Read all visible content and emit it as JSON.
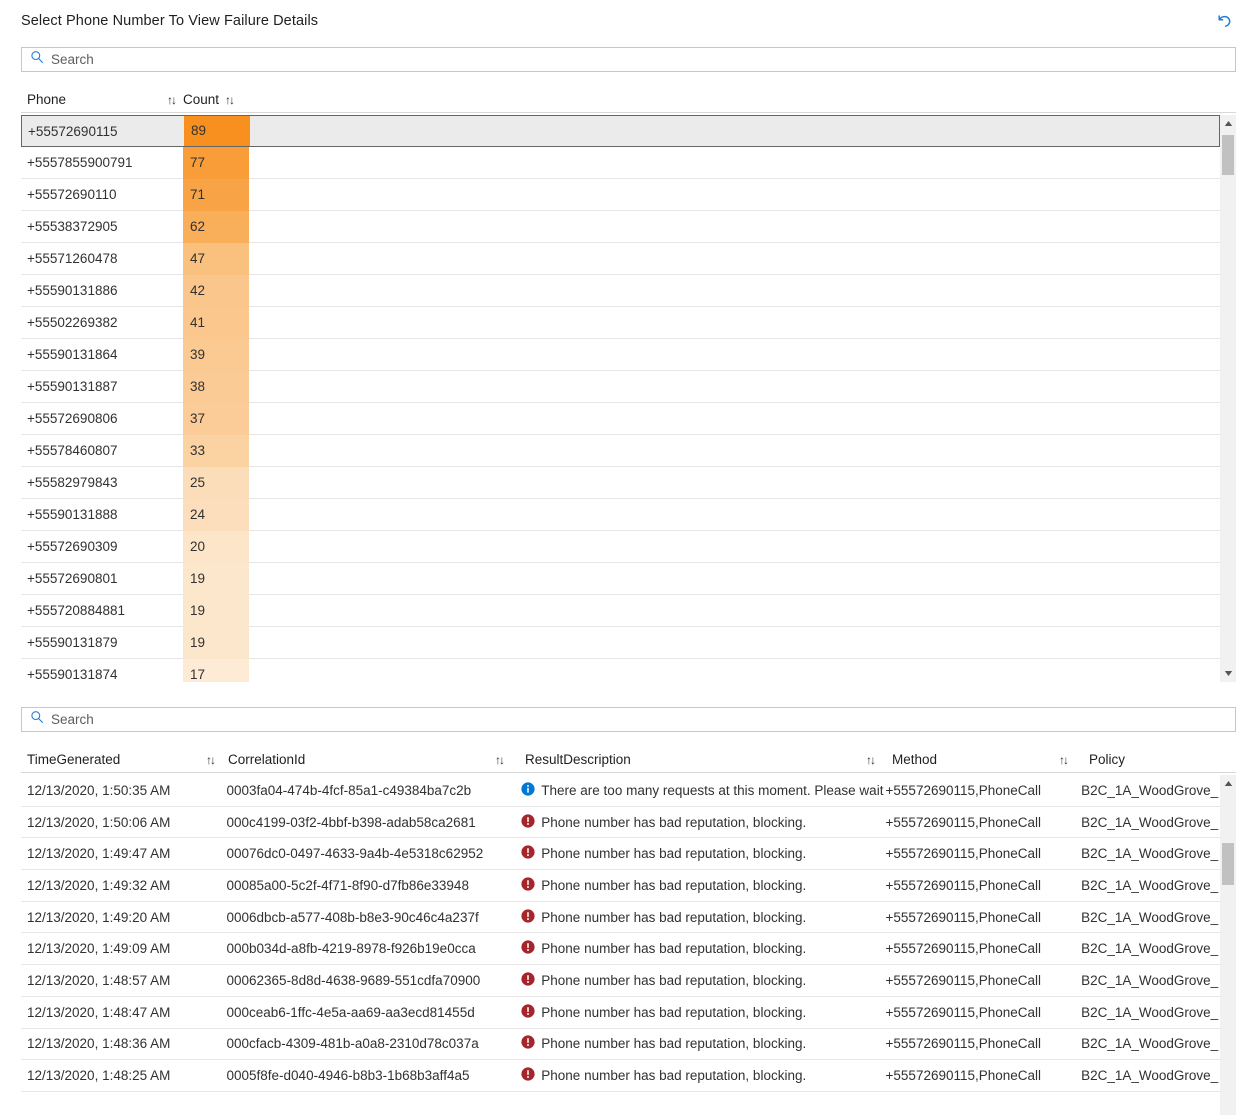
{
  "header": {
    "title": "Select Phone Number To View Failure Details",
    "reset_icon": "undo-arrow-icon"
  },
  "search_top": {
    "placeholder": "Search",
    "value": "",
    "icon": "search-icon"
  },
  "search_bottom": {
    "placeholder": "Search",
    "value": "",
    "icon": "search-icon"
  },
  "colors": {
    "accent_blue": "#0078d4",
    "heat_max": "#f7901e",
    "heat_min": "#fdebd5",
    "error_red": "#a4262c",
    "info_blue": "#0078d4",
    "selected_row_bg": "#ebebeb",
    "grid_line": "#e6e6e6"
  },
  "phones_grid": {
    "columns": [
      {
        "label": "Phone",
        "sort_icon": "sort-arrows-icon"
      },
      {
        "label": "Count",
        "sort_icon": "sort-arrows-icon"
      }
    ],
    "selected_index": 0,
    "rows": [
      {
        "phone": "+55572690115",
        "count": "89"
      },
      {
        "phone": "+5557855900791",
        "count": "77"
      },
      {
        "phone": "+55572690110",
        "count": "71"
      },
      {
        "phone": "+55538372905",
        "count": "62"
      },
      {
        "phone": "+55571260478",
        "count": "47"
      },
      {
        "phone": "+55590131886",
        "count": "42"
      },
      {
        "phone": "+55502269382",
        "count": "41"
      },
      {
        "phone": "+55590131864",
        "count": "39"
      },
      {
        "phone": "+55590131887",
        "count": "38"
      },
      {
        "phone": "+55572690806",
        "count": "37"
      },
      {
        "phone": "+55578460807",
        "count": "33"
      },
      {
        "phone": "+55582979843",
        "count": "25"
      },
      {
        "phone": "+55590131888",
        "count": "24"
      },
      {
        "phone": "+55572690309",
        "count": "20"
      },
      {
        "phone": "+55572690801",
        "count": "19"
      },
      {
        "phone": "+555720884881",
        "count": "19"
      },
      {
        "phone": "+55590131879",
        "count": "19"
      },
      {
        "phone": "+55590131874",
        "count": "17"
      }
    ]
  },
  "logs_grid": {
    "columns": [
      {
        "label": "TimeGenerated",
        "sort_icon": "sort-arrows-icon"
      },
      {
        "label": "CorrelationId",
        "sort_icon": "sort-arrows-icon"
      },
      {
        "label": "ResultDescription",
        "sort_icon": "sort-arrows-icon"
      },
      {
        "label": "Method",
        "sort_icon": "sort-arrows-icon"
      },
      {
        "label": "Policy",
        "sort_icon": null
      }
    ],
    "rows": [
      {
        "time": "12/13/2020, 1:50:35 AM",
        "correlation_id": "0003fa04-474b-4fcf-85a1-c49384ba7c2b",
        "severity": "info",
        "severity_icon": "info-circle-icon",
        "result_description": "There are too many requests at this moment. Please wait fo",
        "method": "+55572690115,PhoneCall",
        "policy": "B2C_1A_WoodGrove_"
      },
      {
        "time": "12/13/2020, 1:50:06 AM",
        "correlation_id": "000c4199-03f2-4bbf-b398-adab58ca2681",
        "severity": "error",
        "severity_icon": "error-circle-icon",
        "result_description": "Phone number has bad reputation, blocking.",
        "method": "+55572690115,PhoneCall",
        "policy": "B2C_1A_WoodGrove_"
      },
      {
        "time": "12/13/2020, 1:49:47 AM",
        "correlation_id": "00076dc0-0497-4633-9a4b-4e5318c62952",
        "severity": "error",
        "severity_icon": "error-circle-icon",
        "result_description": "Phone number has bad reputation, blocking.",
        "method": "+55572690115,PhoneCall",
        "policy": "B2C_1A_WoodGrove_"
      },
      {
        "time": "12/13/2020, 1:49:32 AM",
        "correlation_id": "00085a00-5c2f-4f71-8f90-d7fb86e33948",
        "severity": "error",
        "severity_icon": "error-circle-icon",
        "result_description": "Phone number has bad reputation, blocking.",
        "method": "+55572690115,PhoneCall",
        "policy": "B2C_1A_WoodGrove_"
      },
      {
        "time": "12/13/2020, 1:49:20 AM",
        "correlation_id": "0006dbcb-a577-408b-b8e3-90c46c4a237f",
        "severity": "error",
        "severity_icon": "error-circle-icon",
        "result_description": "Phone number has bad reputation, blocking.",
        "method": "+55572690115,PhoneCall",
        "policy": "B2C_1A_WoodGrove_"
      },
      {
        "time": "12/13/2020, 1:49:09 AM",
        "correlation_id": "000b034d-a8fb-4219-8978-f926b19e0cca",
        "severity": "error",
        "severity_icon": "error-circle-icon",
        "result_description": "Phone number has bad reputation, blocking.",
        "method": "+55572690115,PhoneCall",
        "policy": "B2C_1A_WoodGrove_"
      },
      {
        "time": "12/13/2020, 1:48:57 AM",
        "correlation_id": "00062365-8d8d-4638-9689-551cdfa70900",
        "severity": "error",
        "severity_icon": "error-circle-icon",
        "result_description": "Phone number has bad reputation, blocking.",
        "method": "+55572690115,PhoneCall",
        "policy": "B2C_1A_WoodGrove_"
      },
      {
        "time": "12/13/2020, 1:48:47 AM",
        "correlation_id": "000ceab6-1ffc-4e5a-aa69-aa3ecd81455d",
        "severity": "error",
        "severity_icon": "error-circle-icon",
        "result_description": "Phone number has bad reputation, blocking.",
        "method": "+55572690115,PhoneCall",
        "policy": "B2C_1A_WoodGrove_"
      },
      {
        "time": "12/13/2020, 1:48:36 AM",
        "correlation_id": "000cfacb-4309-481b-a0a8-2310d78c037a",
        "severity": "error",
        "severity_icon": "error-circle-icon",
        "result_description": "Phone number has bad reputation, blocking.",
        "method": "+55572690115,PhoneCall",
        "policy": "B2C_1A_WoodGrove_"
      },
      {
        "time": "12/13/2020, 1:48:25 AM",
        "correlation_id": "0005f8fe-d040-4946-b8b3-1b68b3aff4a5",
        "severity": "error",
        "severity_icon": "error-circle-icon",
        "result_description": "Phone number has bad reputation, blocking.",
        "method": "+55572690115,PhoneCall",
        "policy": "B2C_1A_WoodGrove_"
      }
    ]
  },
  "chart_data": {
    "type": "bar",
    "title": "Select Phone Number To View Failure Details",
    "xlabel": "Phone",
    "ylabel": "Count",
    "categories": [
      "+55572690115",
      "+5557855900791",
      "+55572690110",
      "+55538372905",
      "+55571260478",
      "+55590131886",
      "+55502269382",
      "+55590131864",
      "+55590131887",
      "+55572690806",
      "+55578460807",
      "+55582979843",
      "+55590131888",
      "+55572690309",
      "+55572690801",
      "+555720884881",
      "+55590131879",
      "+55590131874"
    ],
    "values": [
      89,
      77,
      71,
      62,
      47,
      42,
      41,
      39,
      38,
      37,
      33,
      25,
      24,
      20,
      19,
      19,
      19,
      17
    ],
    "ylim": [
      0,
      89
    ],
    "grid": false,
    "legend": false
  }
}
